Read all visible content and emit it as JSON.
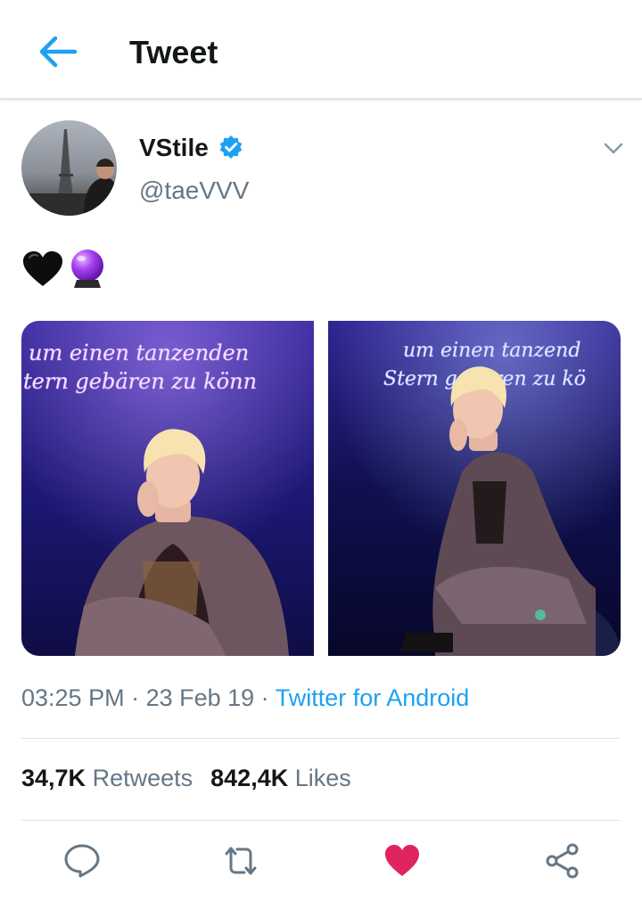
{
  "header": {
    "title": "Tweet"
  },
  "user": {
    "name": "VStile",
    "handle": "@taeVVV"
  },
  "tweet": {
    "emojis": [
      "black-heart-icon",
      "crystal-ball-icon"
    ],
    "photos": [
      "photo-1",
      "photo-2"
    ],
    "photo_text": {
      "left_line_1": "um einen tanzenden",
      "left_line_2": "tern gebären zu könn",
      "right_line_1": "um einen tanzend",
      "right_line_2": "Stern gebären zu kö"
    },
    "time": "03:25 PM",
    "sep1": " · ",
    "date": "23 Feb 19",
    "sep2": " · ",
    "source": "Twitter for Android"
  },
  "stats": {
    "retweets_count": "34,7K",
    "retweets_label": "Retweets",
    "likes_count": "842,4K",
    "likes_label": "Likes"
  },
  "colors": {
    "accent": "#1da1f2",
    "like": "#e0245e",
    "secondary_text": "#657786",
    "divider": "#dfe3e7"
  },
  "actions": [
    "reply-icon",
    "retweet-icon",
    "like-icon",
    "share-icon"
  ]
}
